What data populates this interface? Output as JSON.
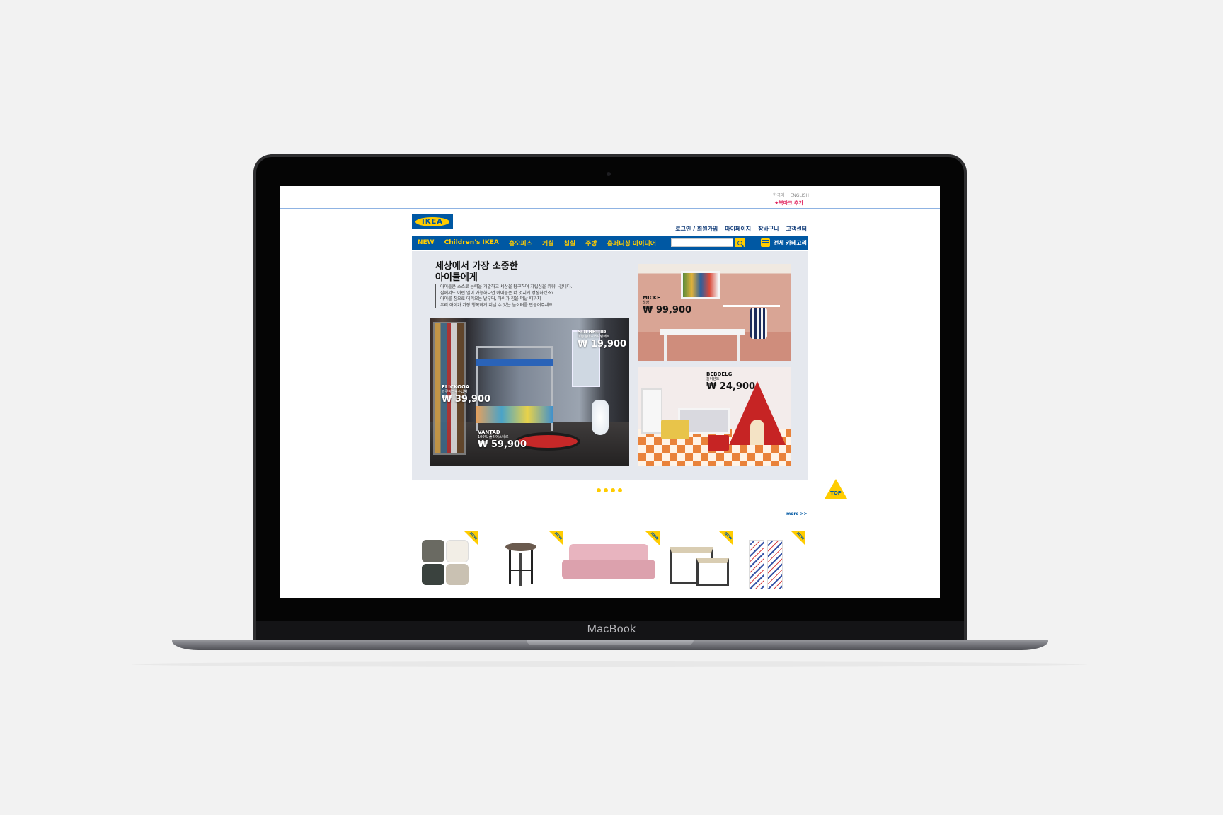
{
  "device": {
    "label": "MacBook"
  },
  "util": {
    "lang_ko": "한국어",
    "lang_en": "ENGLISH",
    "bookmark": "★북마크 추가"
  },
  "header": {
    "logo": "IKEA",
    "usernav": [
      "로그인 / 회원가입",
      "마이페이지",
      "장바구니",
      "고객센터"
    ]
  },
  "nav": {
    "items": [
      "NEW",
      "Children's IKEA",
      "홈오피스",
      "거실",
      "침실",
      "주방",
      "홈퍼니싱 아이디어"
    ],
    "search_placeholder": "",
    "category_label": "전체 카테고리"
  },
  "hero": {
    "title_line1": "세상에서 가장 소중한",
    "title_line2": "아이들에게",
    "desc": [
      "아이들은 스스로 능력을 개발하고 세상을 탐구하며 자립심을 키워나갑니다.",
      "집에서도 이런 일이 가능하다면 아이들은 더 멋지게 성장하겠죠?",
      "아이를 침으로 데려오는 날부터, 아이가 집을 떠날 때까지",
      "우리 아이가 가장 행복하게 지낼 수 있는 놀이터를 만들어주세요."
    ],
    "tags": [
      {
        "name": "SOLBRUID",
        "sub": "이층침대+스프링매트",
        "price": "₩ 19,900"
      },
      {
        "name": "FLICKOGA",
        "sub": "의류정리+수납벽",
        "price": "₩ 39,900"
      },
      {
        "name": "VANTAD",
        "sub": "100% 폴리에스테르",
        "price": "₩ 59,900"
      },
      {
        "name": "MICKE",
        "sub": "책상",
        "price": "₩ 99,900"
      },
      {
        "name": "BEBOELG",
        "sub": "놀이텐트",
        "price": "₩ 24,900"
      }
    ]
  },
  "carousel": {
    "dot_count": 4
  },
  "top_button": "TOP",
  "products": {
    "more_label": "more >>",
    "new_badge": "NEW",
    "items": [
      "cushion-set",
      "bar-stool",
      "pink-sofa",
      "nesting-tables",
      "curtains"
    ]
  },
  "colors": {
    "brand_blue": "#0058a3",
    "brand_yellow": "#ffcc00",
    "accent_pink": "#e0245e"
  }
}
